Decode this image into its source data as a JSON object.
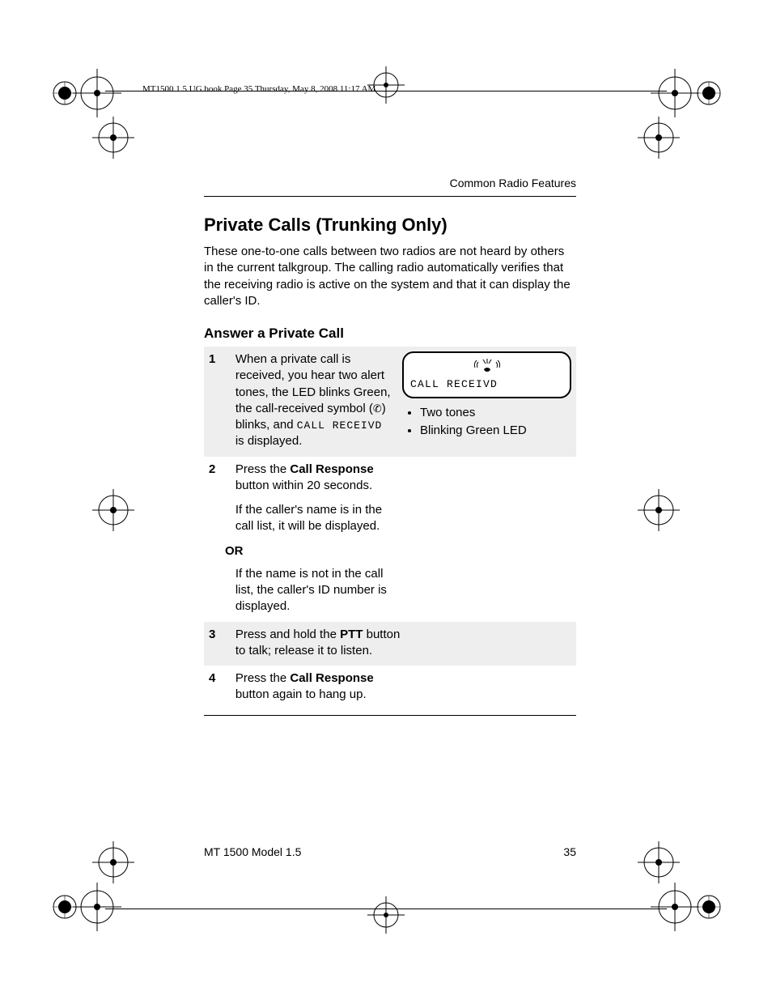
{
  "meta": {
    "book_header": "MT1500 1.5 UG.book  Page 35  Thursday, May 8, 2008  11:17 AM"
  },
  "header": {
    "running": "Common Radio Features"
  },
  "section": {
    "title": "Private Calls (Trunking Only)",
    "intro": "These one-to-one calls between two radios are not heard by others in the current talkgroup. The calling radio automatically verifies that the receiving radio is active on the system and that it can display the caller's ID.",
    "subhead": "Answer a Private Call"
  },
  "steps": {
    "s1": {
      "num": "1",
      "pre": "When a private call is received, you hear two alert tones, the LED blinks Green, the call-received symbol (",
      "post_a": ") blinks, and ",
      "lcd_word": "CALL RECEIVD",
      "post_b": " is displayed."
    },
    "s2": {
      "num": "2",
      "line1_a": "Press the ",
      "line1_b": "Call Response",
      "line1_c": " button within 20 seconds.",
      "line2": "If the caller's name is in the call list, it will be displayed."
    },
    "or_label": "OR",
    "or_text": "If the name is not in the call list, the caller's ID number is displayed.",
    "s3": {
      "num": "3",
      "a": "Press and hold the ",
      "b": "PTT",
      "c": " button to talk; release it to listen."
    },
    "s4": {
      "num": "4",
      "a": "Press the ",
      "b": "Call Response",
      "c": " button again to hang up."
    }
  },
  "lcd": {
    "line": "CALL RECEIVD"
  },
  "indicators": {
    "i1": "Two tones",
    "i2": "Blinking Green LED"
  },
  "footer": {
    "model": "MT 1500 Model 1.5",
    "page": "35"
  }
}
